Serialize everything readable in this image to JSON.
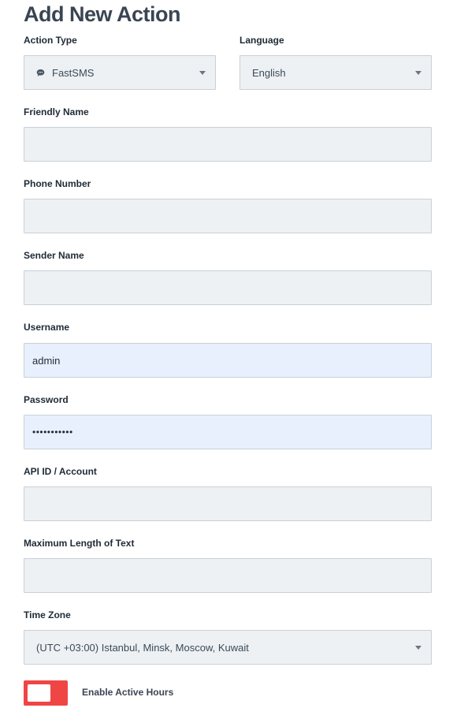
{
  "page": {
    "title": "Add New Action"
  },
  "form": {
    "action_type": {
      "label": "Action Type",
      "value": "FastSMS",
      "icon": "chat-bubble-icon"
    },
    "language": {
      "label": "Language",
      "value": "English"
    },
    "friendly_name": {
      "label": "Friendly Name",
      "value": ""
    },
    "phone_number": {
      "label": "Phone Number",
      "value": ""
    },
    "sender_name": {
      "label": "Sender Name",
      "value": ""
    },
    "username": {
      "label": "Username",
      "value": "admin"
    },
    "password": {
      "label": "Password",
      "value": "•••••••••••"
    },
    "api_id": {
      "label": "API ID / Account",
      "value": ""
    },
    "max_length": {
      "label": "Maximum Length of Text",
      "value": ""
    },
    "time_zone": {
      "label": "Time Zone",
      "value": "(UTC +03:00) Istanbul, Minsk, Moscow, Kuwait"
    },
    "active_hours": {
      "label": "Enable Active Hours",
      "enabled": false
    }
  },
  "colors": {
    "field_bg": "#edf1f4",
    "autofill_bg": "#e8f0fe",
    "toggle_bg": "#f04545"
  }
}
